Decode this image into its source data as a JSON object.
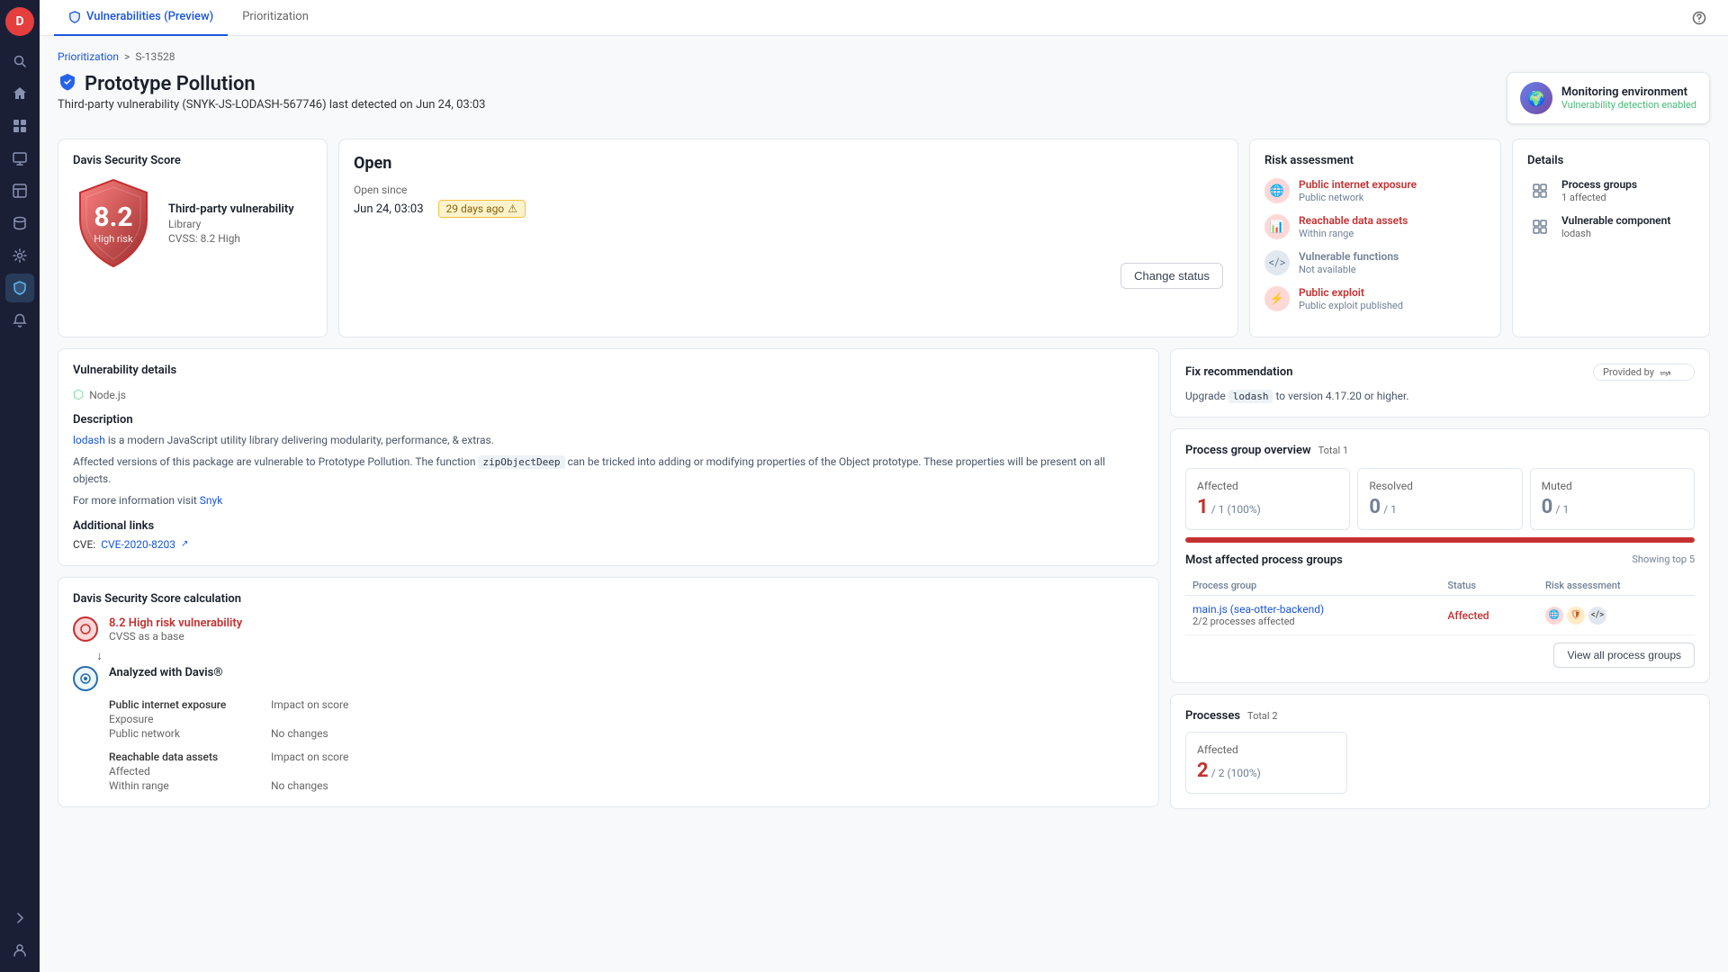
{
  "app": {
    "title": "Vulnerabilities (Preview)",
    "tabs": [
      {
        "id": "vulnerabilities",
        "label": "Vulnerabilities (Preview)",
        "active": true
      },
      {
        "id": "prioritization",
        "label": "Prioritization",
        "active": false
      }
    ]
  },
  "breadcrumb": {
    "parent": "Prioritization",
    "separator": ">",
    "current": "S-13528"
  },
  "page": {
    "title": "Prototype Pollution",
    "subtitle": "Third-party vulnerability (SNYK-JS-LODASH-567746) last detected on Jun 24, 03:03"
  },
  "monitoring": {
    "environment": "Monitoring environment",
    "status": "Vulnerability detection enabled"
  },
  "davis_score": {
    "card_title": "Davis Security Score",
    "score": "8.2",
    "risk_level": "High risk",
    "type": "Third-party vulnerability",
    "subtype": "Library",
    "cvss": "CVSS: 8.2 High"
  },
  "open": {
    "status": "Open",
    "since_label": "Open since",
    "since_date": "Jun 24, 03:03",
    "days_ago": "29 days ago",
    "change_status_label": "Change status"
  },
  "risk_assessment": {
    "title": "Risk assessment",
    "items": [
      {
        "id": "internet",
        "name": "Public internet exposure",
        "desc": "Public network",
        "severity": "red"
      },
      {
        "id": "data",
        "name": "Reachable data assets",
        "desc": "Within range",
        "severity": "red"
      },
      {
        "id": "functions",
        "name": "Vulnerable functions",
        "desc": "Not available",
        "severity": "gray"
      },
      {
        "id": "exploit",
        "name": "Public exploit",
        "desc": "Public exploit published",
        "severity": "red"
      }
    ]
  },
  "details": {
    "title": "Details",
    "process_groups": {
      "label": "Process groups",
      "value": "1 affected"
    },
    "vulnerable_component": {
      "label": "Vulnerable component",
      "value": "lodash"
    }
  },
  "vulnerability_details": {
    "title": "Vulnerability details",
    "technology": "Node.js",
    "description_title": "Description",
    "description": "lodash is a modern JavaScript utility library delivering modularity, performance, & extras.",
    "affected_text": "Affected versions of this package are vulnerable to Prototype Pollution. The function",
    "function_name": "zipObjectDeep",
    "affected_text2": "can be tricked into adding or modifying properties of the Object prototype. These properties will be present on all objects.",
    "more_info": "For more information visit",
    "snyk_link": "Snyk",
    "additional_links_title": "Additional links",
    "cve_label": "CVE:",
    "cve_link": "CVE-2020-8203"
  },
  "fix_recommendation": {
    "title": "Fix recommendation",
    "provided_by": "Provided by",
    "provider": "snyk",
    "upgrade_text": "Upgrade",
    "package": "lodash",
    "version_text": "to version 4.17.20 or higher."
  },
  "process_group_overview": {
    "title": "Process group overview",
    "total": "Total 1",
    "affected": {
      "label": "Affected",
      "value": "1",
      "detail": "/ 1 (100%)"
    },
    "resolved": {
      "label": "Resolved",
      "value": "0",
      "detail": "/ 1"
    },
    "muted": {
      "label": "Muted",
      "value": "0",
      "detail": "/ 1"
    },
    "progress_pct": 100
  },
  "most_affected": {
    "title": "Most affected process groups",
    "showing": "Showing top 5",
    "columns": [
      "Process group",
      "Status",
      "Risk assessment"
    ],
    "rows": [
      {
        "name": "main.js (sea-otter-backend)",
        "processes_affected": "2/2 processes affected",
        "status": "Affected",
        "risks": [
          "internet",
          "shield",
          "code"
        ]
      }
    ],
    "view_all_label": "View all process groups"
  },
  "processes": {
    "title": "Processes",
    "total": "Total 2",
    "affected_label": "Affected",
    "affected_value": "2",
    "affected_detail": "/ 2 (100%)"
  },
  "davis_calc": {
    "title": "Davis Security Score calculation",
    "step1": {
      "score": "8.2",
      "label": "High risk vulnerability",
      "sublabel": "CVSS as a base"
    },
    "step2": {
      "label": "Analyzed with Davis®"
    },
    "details": [
      {
        "label": "Public internet exposure"
      },
      {
        "label": "Impact on score"
      },
      {
        "label": "Exposure"
      },
      {
        "label": ""
      },
      {
        "label": "Public network"
      },
      {
        "label": "No changes"
      },
      {
        "label": "Reachable data assets"
      },
      {
        "label": "Impact on score"
      },
      {
        "label": "Affected"
      },
      {
        "label": ""
      },
      {
        "label": "Within range"
      },
      {
        "label": "No changes"
      }
    ]
  },
  "sidebar": {
    "icons": [
      {
        "id": "logo",
        "symbol": "🔴",
        "type": "logo"
      },
      {
        "id": "search",
        "symbol": "🔍",
        "active": false
      },
      {
        "id": "home",
        "symbol": "⌂",
        "active": false
      },
      {
        "id": "apps",
        "symbol": "⋮⋮",
        "active": false
      },
      {
        "id": "infrastructure",
        "symbol": "🖥",
        "active": false
      },
      {
        "id": "apps2",
        "symbol": "📱",
        "active": false
      },
      {
        "id": "databases",
        "symbol": "🗄",
        "active": false
      },
      {
        "id": "settings",
        "symbol": "⚙",
        "active": false
      },
      {
        "id": "security",
        "symbol": "🛡",
        "active": true
      },
      {
        "id": "alerts",
        "symbol": "🔔",
        "active": false
      },
      {
        "id": "expand",
        "symbol": "»",
        "active": false
      }
    ]
  }
}
